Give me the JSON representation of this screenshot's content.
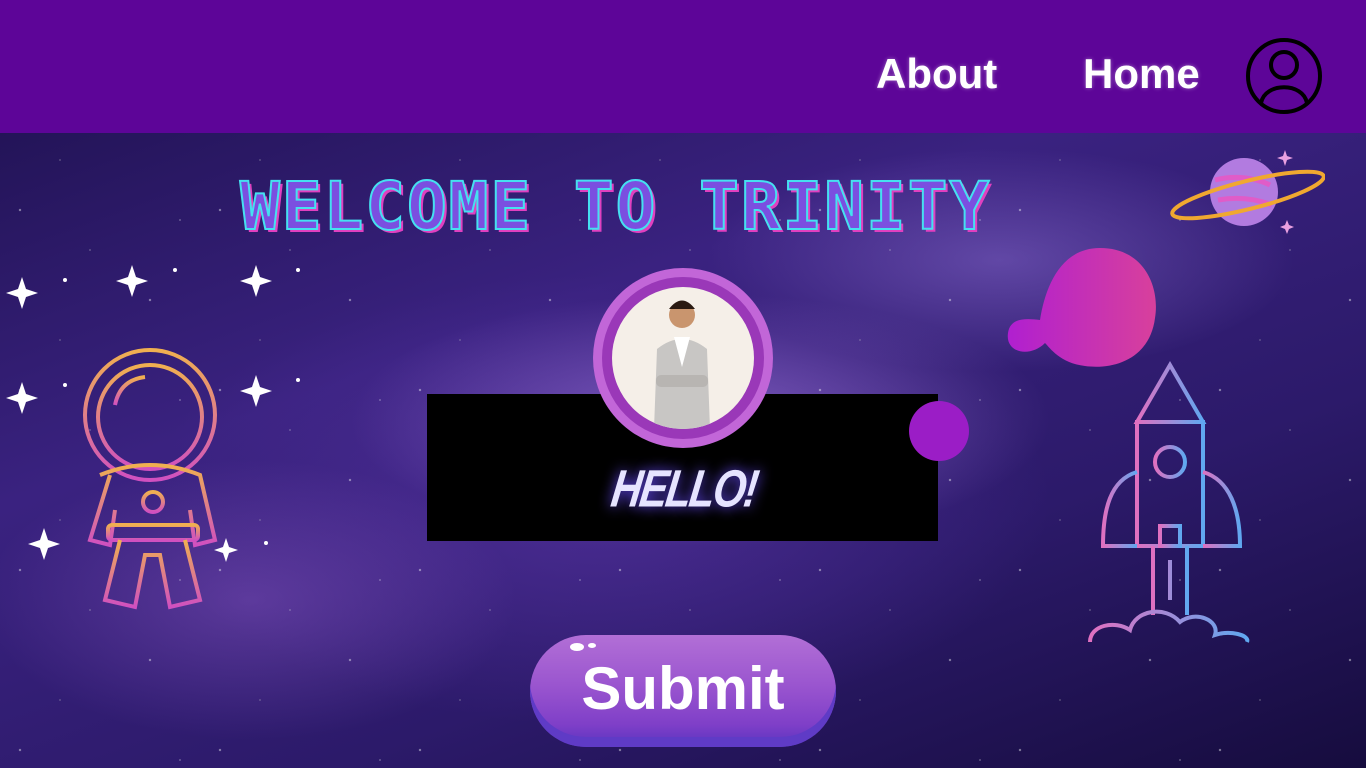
{
  "nav": {
    "about": "About",
    "home": "Home",
    "user_icon": "user-circle-icon"
  },
  "hero": {
    "title": "WELCOME TO TRINITY"
  },
  "card": {
    "greeting": "HELLO!"
  },
  "actions": {
    "submit": "Submit"
  },
  "colors": {
    "nav_bg": "#5d0598",
    "accent": "#9b1dc6",
    "button": "#9a55cf"
  }
}
